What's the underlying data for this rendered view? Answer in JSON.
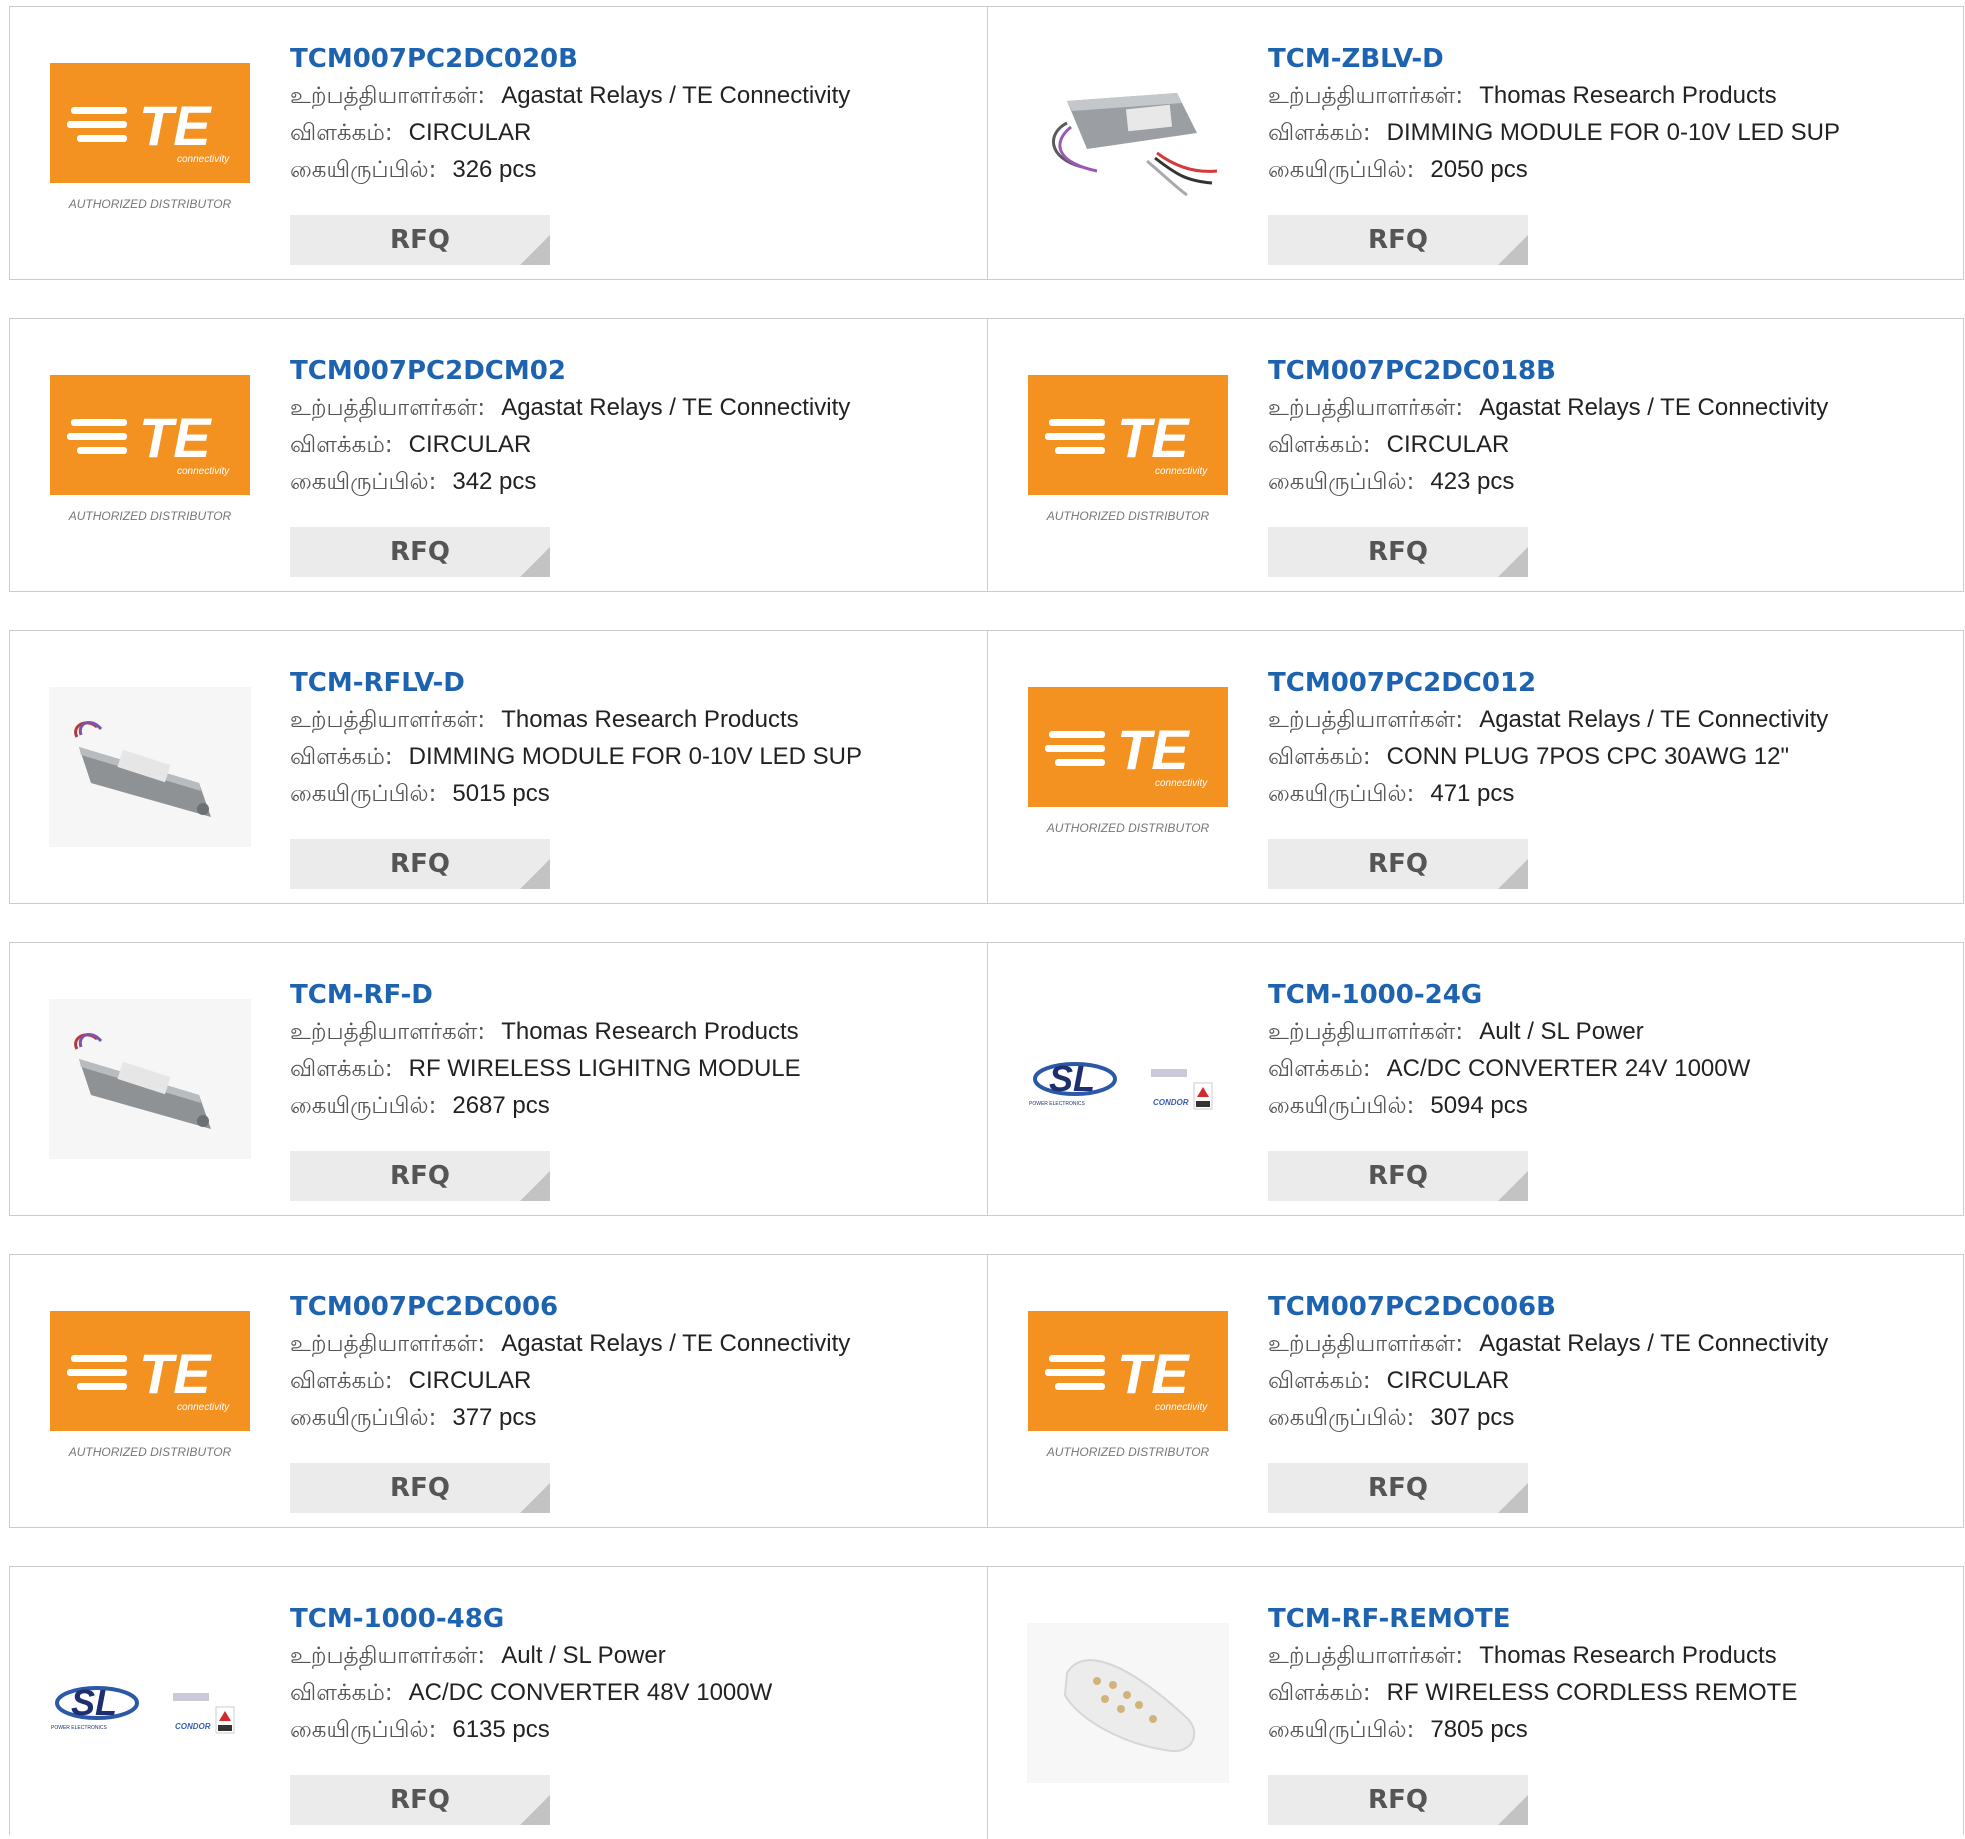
{
  "labels": {
    "manufacturer": "உற்பத்தியாளர்கள்:",
    "description": "விளக்கம்:",
    "stock": "கையிருப்பில்:",
    "rfq": "RFQ"
  },
  "logo_text": {
    "te_brand": "TE",
    "te_sub": "connectivity",
    "authorized": "AUTHORIZED DISTRIBUTOR",
    "sl_brand": "SL",
    "sl_sub": "POWER ELECTRONICS",
    "condor": "CONDOR"
  },
  "colors": {
    "part_link": "#1e63b0",
    "te_orange": "#f39121",
    "rfq_bg": "#ebebeb",
    "border": "#cccccc"
  },
  "products": [
    {
      "part": "TCM007PC2DC020B",
      "manufacturer": "Agastat Relays / TE Connectivity",
      "description": "CIRCULAR",
      "stock": "326 pcs",
      "image": "te-logo"
    },
    {
      "part": "TCM-ZBLV-D",
      "manufacturer": "Thomas Research Products",
      "description": "DIMMING MODULE FOR 0-10V LED SUP",
      "stock": "2050 pcs",
      "image": "dimming-module-photo"
    },
    {
      "part": "TCM007PC2DCM02",
      "manufacturer": "Agastat Relays / TE Connectivity",
      "description": "CIRCULAR",
      "stock": "342 pcs",
      "image": "te-logo"
    },
    {
      "part": "TCM007PC2DC018B",
      "manufacturer": "Agastat Relays / TE Connectivity",
      "description": "CIRCULAR",
      "stock": "423 pcs",
      "image": "te-logo"
    },
    {
      "part": "TCM-RFLV-D",
      "manufacturer": "Thomas Research Products",
      "description": "DIMMING MODULE FOR 0-10V LED SUP",
      "stock": "5015 pcs",
      "image": "module-photo"
    },
    {
      "part": "TCM007PC2DC012",
      "manufacturer": "Agastat Relays / TE Connectivity",
      "description": "CONN PLUG 7POS CPC 30AWG 12\"",
      "stock": "471 pcs",
      "image": "te-logo"
    },
    {
      "part": "TCM-RF-D",
      "manufacturer": "Thomas Research Products",
      "description": "RF WIRELESS LIGHITNG MODULE",
      "stock": "2687 pcs",
      "image": "module-photo"
    },
    {
      "part": "TCM-1000-24G",
      "manufacturer": "Ault / SL Power",
      "description": "AC/DC CONVERTER 24V 1000W",
      "stock": "5094 pcs",
      "image": "sl-logo"
    },
    {
      "part": "TCM007PC2DC006",
      "manufacturer": "Agastat Relays / TE Connectivity",
      "description": "CIRCULAR",
      "stock": "377 pcs",
      "image": "te-logo"
    },
    {
      "part": "TCM007PC2DC006B",
      "manufacturer": "Agastat Relays / TE Connectivity",
      "description": "CIRCULAR",
      "stock": "307 pcs",
      "image": "te-logo"
    },
    {
      "part": "TCM-1000-48G",
      "manufacturer": "Ault / SL Power",
      "description": "AC/DC CONVERTER 48V 1000W",
      "stock": "6135 pcs",
      "image": "sl-logo"
    },
    {
      "part": "TCM-RF-REMOTE",
      "manufacturer": "Thomas Research Products",
      "description": "RF WIRELESS CORDLESS REMOTE",
      "stock": "7805 pcs",
      "image": "remote-photo"
    }
  ]
}
